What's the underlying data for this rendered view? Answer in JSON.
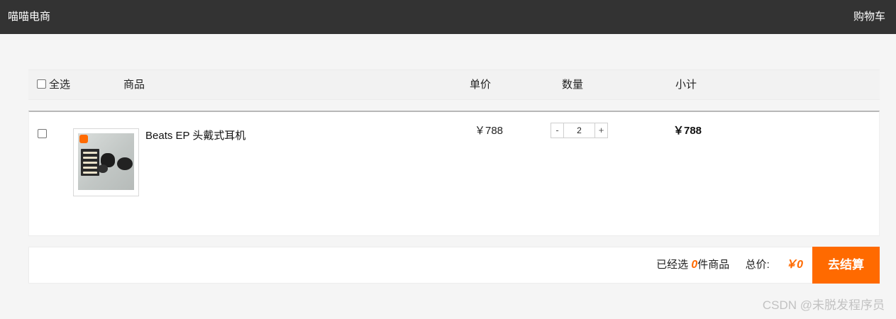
{
  "topbar": {
    "brand": "喵喵电商",
    "cart_link": "购物车"
  },
  "table_header": {
    "select_all": "全选",
    "goods": "商品",
    "unit_price": "单价",
    "quantity": "数量",
    "subtotal": "小计"
  },
  "items": [
    {
      "name": "Beats EP 头戴式耳机",
      "unit_price": "￥788",
      "quantity": "2",
      "subtotal": "￥788",
      "checked": false
    }
  ],
  "qty_controls": {
    "minus": "-",
    "plus": "+"
  },
  "footer": {
    "selected_prefix": "已经选",
    "selected_count": "0",
    "selected_suffix": "件商品",
    "total_label": "总价:",
    "total_value": "￥0",
    "checkout_label": "去结算"
  },
  "watermark": "CSDN @未脱发程序员",
  "colors": {
    "accent": "#ff6a00",
    "topbar": "#333333"
  }
}
